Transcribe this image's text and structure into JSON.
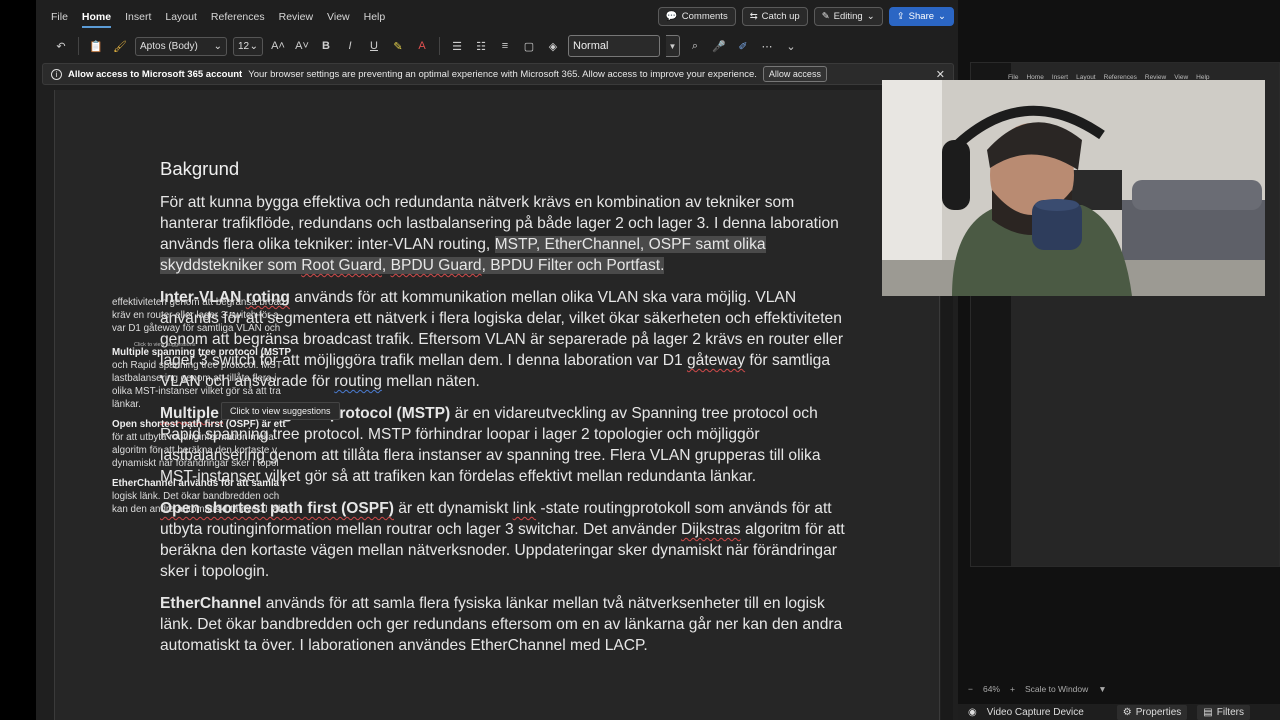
{
  "menu": {
    "items": [
      "File",
      "Home",
      "Insert",
      "Layout",
      "References",
      "Review",
      "View",
      "Help"
    ],
    "active": "Home",
    "comments_label": "Comments",
    "catchup_label": "Catch up",
    "editing_label": "Editing",
    "share_label": "Share"
  },
  "ribbon": {
    "font_name": "Aptos (Body)",
    "font_size": "12",
    "style_name": "Normal"
  },
  "notice": {
    "title": "Allow access to Microsoft 365 account",
    "message": "Your browser settings are preventing an optimal experience with Microsoft 365. Allow access to improve your experience.",
    "button": "Allow access"
  },
  "document": {
    "heading": "Bakgrund",
    "p1": {
      "a": "För att kunna bygga effektiva och redundanta nätverk krävs en kombination av tekniker som hanterar trafikflöde, redundans och lastbalansering på både lager 2 och lager 3. I denna laboration används flera olika tekniker: inter-VLAN routing, ",
      "h1": "MSTP, EtherChannel, OSPF samt olika skyddstekniker som ",
      "root": "Root Guard",
      "h2": ", ",
      "bpdu": "BPDU Guard",
      "h3": ", BPDU Filter och Portfast."
    },
    "p2": {
      "bold1": "Inter-VLAN ",
      "bold2": "roting",
      "a": " används för att kommunikation mellan olika VLAN ska vara möjlig. VLAN används för att segmentera ett nätverk i flera logiska delar, vilket ökar säkerheten och effektiviteten genom att begränsa broadcast trafik. Eftersom VLAN är separerade på lager 2 krävs en router eller lager 3 switch för att möjliggöra trafik mellan dem. I denna laboration var D1 ",
      "gw": "gåteway",
      "b": " för samtliga VLAN och ansvarade för ",
      "routing": "routing",
      "c": " mellan näten."
    },
    "p3": {
      "bold1": "Multiple ",
      "bold2": "spanning tree protocol (MSTP)",
      "a": " är en vidareutveckling av Spanning tree protocol och Rapid spanning tree protocol. MSTP förhindrar loopar i lager 2 topologier och möjliggör lastbalansering genom att tillåta flera instanser av spanning tree. Flera VLAN grupperas till olika MST-instanser vilket gör så att trafiken kan fördelas effektivt mellan redundanta länkar."
    },
    "p4": {
      "bold": "Open shortest path first (OSPF)",
      "a": " är ett dynamiskt ",
      "link": "link",
      "b": " -state routingprotokoll som används för att utbyta routinginformation mellan routrar och lager 3 switchar. Det använder ",
      "dijk": "Dijkstras",
      "c": " algoritm för att beräkna den kortaste vägen mellan nätverksnoder. Uppdateringar sker dynamiskt när förändringar sker i topologin."
    },
    "p5": {
      "bold": "EtherChannel",
      "a": " används för att samla flera fysiska länkar mellan två nätverksenheter till en logisk länk. Det ökar bandbredden och ger redundans eftersom om en av länkarna går ner kan den andra automatiskt ta över. I laborationen användes EtherChannel med LACP."
    },
    "tooltip": "Click to view suggestions"
  },
  "preview": {
    "menu": [
      "File",
      "Home",
      "Insert",
      "Layout",
      "References",
      "Review",
      "View",
      "Help"
    ],
    "lines1": [
      "effektiviteten genom att begränsa broad",
      "kräv en router eller lager 3 switch för a",
      "var D1 gåteway för samtliga VLAN och"
    ],
    "line_mstp": [
      "Multiple spanning tree protocol (MSTP",
      "och Rapid spanning tree protocol. MST",
      "lastbalansering genom att tillåta flera i",
      "olika MST-instanser vilket gör så att tra",
      "länkar."
    ],
    "line_ospf": [
      "Open shortest path first (OSPF) är ett",
      "för att utbyta routinginformation mella",
      "algoritm för att beräkna den kortaste v",
      "dynamiskt när förändringar sker i topol"
    ],
    "line_eth": [
      "EtherChannel används för att samla f",
      "logisk länk. Det ökar bandbredden och",
      "kan den andra automatiskt ta över. I lab"
    ],
    "tooltip": "Click to view suggestions"
  },
  "obs": {
    "zoom": "64%",
    "scale": "Scale to Window",
    "source": "Video Capture Device",
    "properties": "Properties",
    "filters": "Filters"
  }
}
